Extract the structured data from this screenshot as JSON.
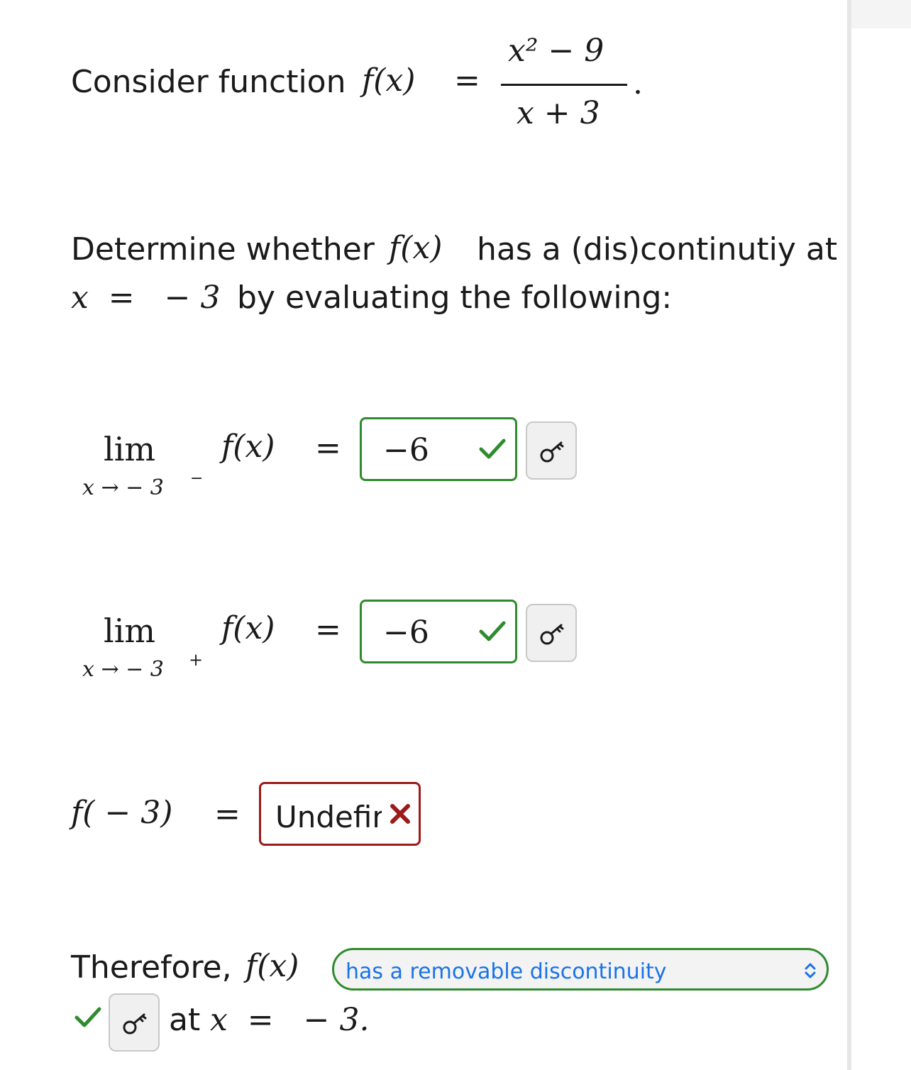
{
  "intro": {
    "text": "Consider function",
    "func": "f(x)",
    "equals": "=",
    "numerator": "x² − 9",
    "denominator": "x + 3",
    "period": "."
  },
  "question": {
    "line1_prefix": "Determine whether",
    "line1_func": "f(x)",
    "line1_suffix": "has a (dis)continutiy at",
    "line2_math": "x  =   − 3",
    "line2_suffix": "by evaluating the following:"
  },
  "limits": [
    {
      "lim": "lim",
      "sub": "x → − 3",
      "sup": "−",
      "func": "f(x)",
      "equals": "=",
      "value": "−6"
    },
    {
      "lim": "lim",
      "sub": "x → − 3",
      "sup": "+",
      "func": "f(x)",
      "equals": "=",
      "value": "−6"
    }
  ],
  "value_at_point": {
    "expr": "f( − 3)",
    "equals": "=",
    "value": "Undefined"
  },
  "conclusion": {
    "prefix": "Therefore,",
    "func": "f(x)",
    "dropdown_value": "has a removable discontinuity",
    "at_text": "at",
    "at_math": "x  =   − 3."
  },
  "colors": {
    "correct": "#2e8b2e",
    "incorrect": "#9b1b1b",
    "link": "#1a73e8"
  },
  "icons": {
    "correct": "checkmark-icon",
    "incorrect": "x-mark-icon",
    "key": "key-icon",
    "dropdown": "up-down-arrows-icon"
  }
}
